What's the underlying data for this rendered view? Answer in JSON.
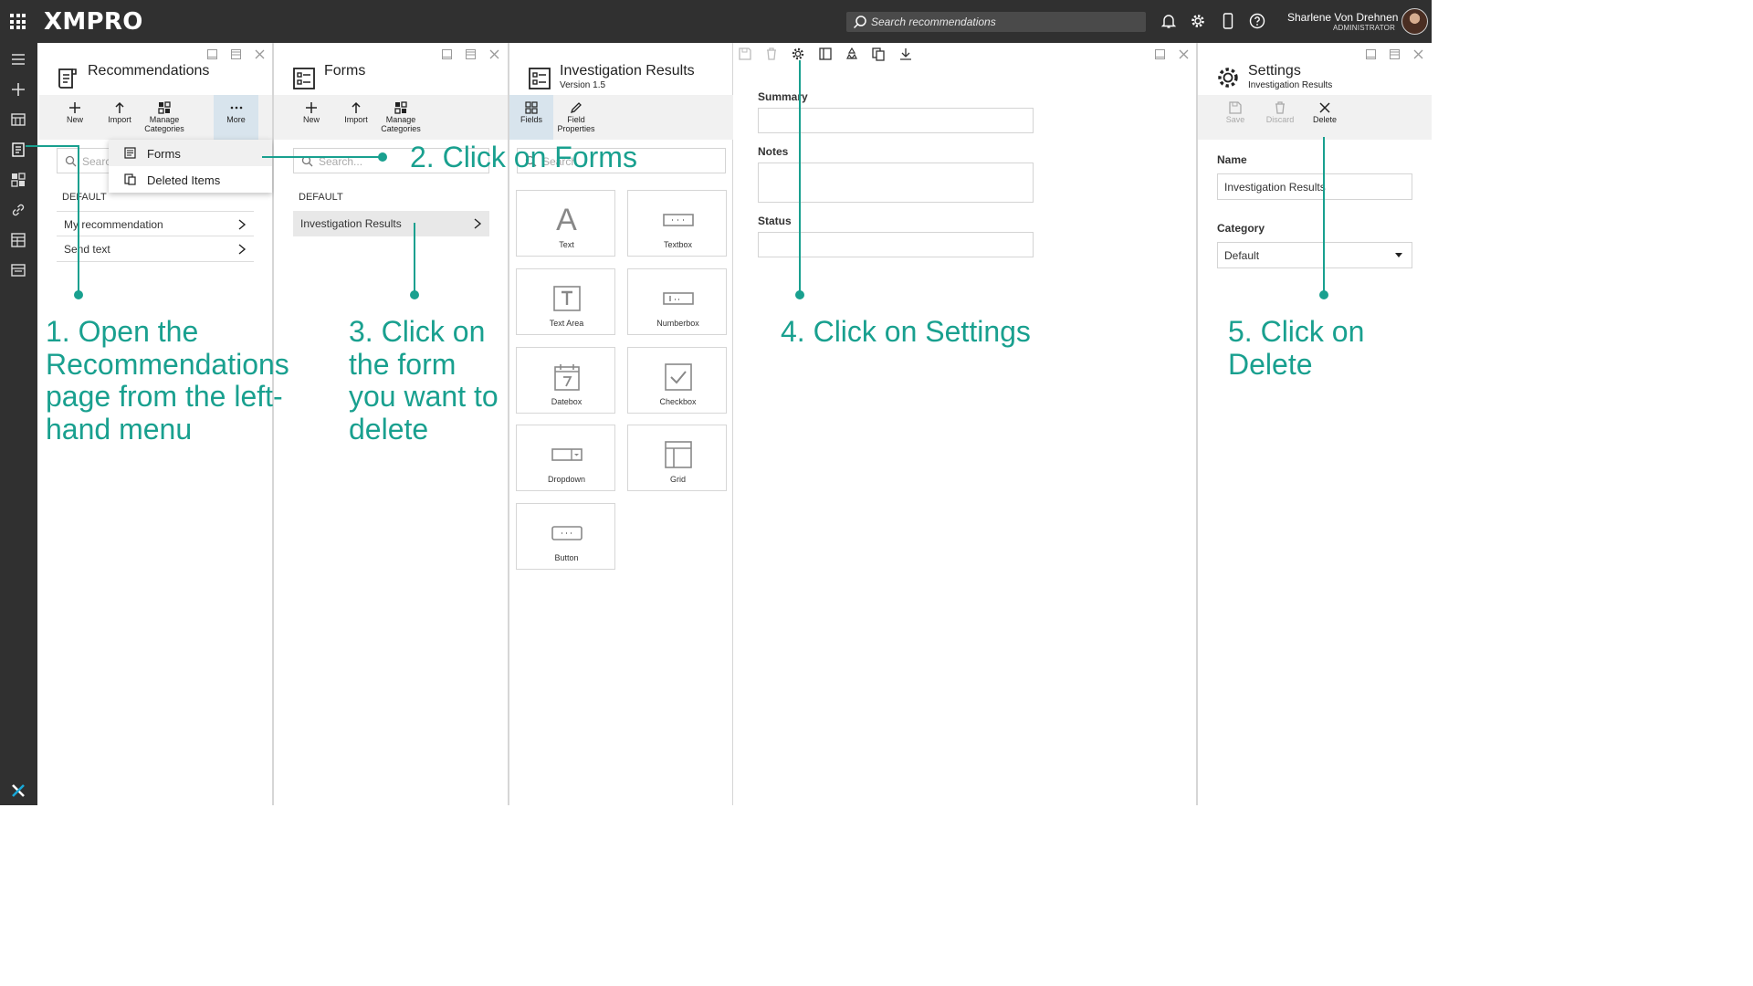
{
  "topbar": {
    "logo": "XMPRO",
    "search_placeholder": "Search recommendations",
    "user_name": "Sharlene Von Drehnen",
    "user_role": "ADMINISTRATOR"
  },
  "recommendations": {
    "title": "Recommendations",
    "toolbar": {
      "new": "New",
      "import": "Import",
      "manage": "Manage Categories",
      "more": "More"
    },
    "search_placeholder": "Search...",
    "category": "DEFAULT",
    "items": [
      "My recommendation",
      "Send text"
    ],
    "more_menu": [
      "Forms",
      "Deleted Items"
    ]
  },
  "forms": {
    "title": "Forms",
    "toolbar": {
      "new": "New",
      "import": "Import",
      "manage": "Manage Categories"
    },
    "search_placeholder": "Search...",
    "category": "DEFAULT",
    "items": [
      "Investigation Results"
    ]
  },
  "designer": {
    "title": "Investigation Results",
    "version": "Version 1.5",
    "tabs": {
      "fields": "Fields",
      "properties": "Field Properties"
    },
    "search_placeholder": "Search",
    "fields": [
      "Text",
      "Textbox",
      "Text Area",
      "Numberbox",
      "Datebox",
      "Checkbox",
      "Dropdown",
      "Grid",
      "Button"
    ]
  },
  "canvas": {
    "labels": [
      "Summary",
      "Notes",
      "Status"
    ]
  },
  "settings": {
    "title": "Settings",
    "subtitle": "Investigation Results",
    "toolbar": {
      "save": "Save",
      "discard": "Discard",
      "delete": "Delete"
    },
    "name_label": "Name",
    "name_value": "Investigation Results",
    "category_label": "Category",
    "category_value": "Default"
  },
  "annotations": {
    "step1": "1. Open the Recommendations page from the left-hand menu",
    "step2": "2. Click on Forms",
    "step3": "3. Click on the form you want to delete",
    "step4": "4. Click on Settings",
    "step5": "5. Click on Delete"
  },
  "colors": {
    "topbar": "#303030",
    "accent": "#19a08f",
    "panel_header": "#f1f1f1"
  }
}
